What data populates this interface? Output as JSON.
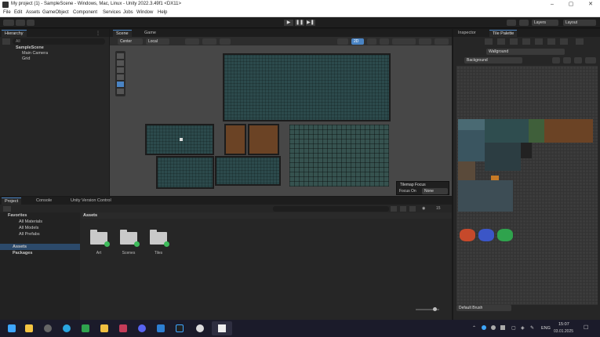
{
  "window": {
    "title": "My project (1) - SampleScene - Windows, Mac, Linux - Unity 2022.3.49f1 <DX11>",
    "minimize": "–",
    "maximize": "▢",
    "close": "✕"
  },
  "menu": [
    "File",
    "Edit",
    "Assets",
    "GameObject",
    "Component",
    "Services",
    "Jobs",
    "Window",
    "Help"
  ],
  "toolbar": {
    "layers_label": "Layers",
    "layout_label": "Layout"
  },
  "hierarchy": {
    "tab": "Hierarchy",
    "search_placeholder": "All",
    "items": [
      "SampleScene",
      "Main Camera",
      "Grid"
    ]
  },
  "scene": {
    "tab_scene": "Scene",
    "tab_game": "Game",
    "pivot_label": "Center",
    "space_label": "Local",
    "mode_label": "2D",
    "overlay_title": "Tilemap Focus",
    "overlay_focus_label": "Focus On",
    "overlay_focus_value": "None"
  },
  "inspector": {
    "tab_inspector": "Inspector",
    "tab_palette": "Tile Palette",
    "active_tilemap": "Wallground",
    "palette_name": "Background",
    "default_brush": "Default Brush"
  },
  "project": {
    "tab_project": "Project",
    "tab_console": "Console",
    "tab_vc": "Unity Version Control",
    "favorites_label": "Favorites",
    "favorites": [
      "All Materials",
      "All Models",
      "All Prefabs"
    ],
    "assets_label": "Assets",
    "packages_label": "Packages",
    "breadcrumb": "Assets",
    "count_label": "15",
    "folders": [
      "Art",
      "Scenes",
      "Tiles"
    ]
  },
  "taskbar": {
    "lang": "ENG",
    "time": "15:07",
    "date": "03.01.2025"
  },
  "colors": {
    "accent": "#4a84c4",
    "vc_badge": "#3dbb5a"
  }
}
